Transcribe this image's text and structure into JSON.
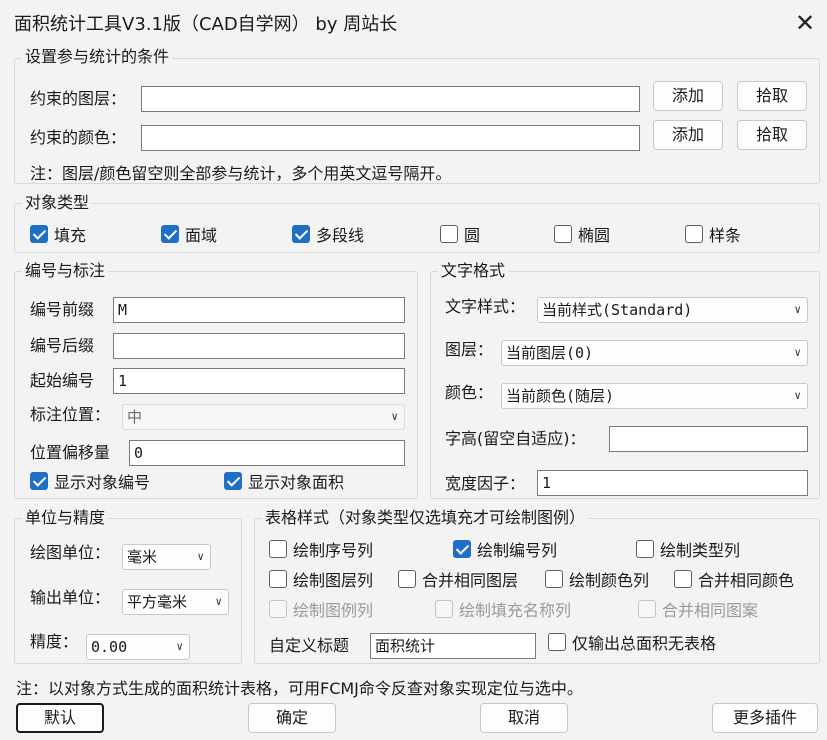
{
  "window": {
    "title": "面积统计工具V3.1版（CAD自学网） by 周站长",
    "close_glyph": "✕"
  },
  "conditions": {
    "title": "设置参与统计的条件",
    "layer_label": "约束的图层：",
    "layer_value": "",
    "color_label": "约束的颜色：",
    "color_value": "",
    "add_label": "添加",
    "pick_label": "拾取",
    "note": "注：图层/颜色留空则全部参与统计，多个用英文逗号隔开。"
  },
  "object_types": {
    "title": "对象类型",
    "items": [
      {
        "label": "填充",
        "checked": true
      },
      {
        "label": "面域",
        "checked": true
      },
      {
        "label": "多段线",
        "checked": true
      },
      {
        "label": "圆",
        "checked": false
      },
      {
        "label": "椭圆",
        "checked": false
      },
      {
        "label": "样条",
        "checked": false
      }
    ]
  },
  "numbering": {
    "title": "编号与标注",
    "prefix_label": "编号前缀",
    "prefix_value": "M",
    "suffix_label": "编号后缀",
    "suffix_value": "",
    "start_label": "起始编号",
    "start_value": "1",
    "position_label": "标注位置：",
    "position_value": "中",
    "offset_label": "位置偏移量",
    "offset_value": "0",
    "show_number_label": "显示对象编号",
    "show_number_checked": true,
    "show_area_label": "显示对象面积",
    "show_area_checked": true
  },
  "text_format": {
    "title": "文字格式",
    "style_label": "文字样式：",
    "style_value": "当前样式(Standard)",
    "layer_label": "图层：",
    "layer_value": "当前图层(0)",
    "color_label": "颜色：",
    "color_value": "当前颜色(随层)",
    "height_label": "字高(留空自适应)：",
    "height_value": "",
    "width_label": "宽度因子：",
    "width_value": "1"
  },
  "units": {
    "title": "单位与精度",
    "draw_unit_label": "绘图单位：",
    "draw_unit_value": "毫米",
    "out_unit_label": "输出单位：",
    "out_unit_value": "平方毫米",
    "precision_label": "精度：",
    "precision_value": "0.00"
  },
  "table": {
    "title": "表格样式（对象类型仅选填充才可绘制图例）",
    "options": [
      {
        "label": "绘制序号列",
        "checked": false,
        "enabled": true
      },
      {
        "label": "绘制编号列",
        "checked": true,
        "enabled": true
      },
      {
        "label": "绘制类型列",
        "checked": false,
        "enabled": true
      },
      {
        "label": "绘制图层列",
        "checked": false,
        "enabled": true
      },
      {
        "label": "合并相同图层",
        "checked": false,
        "enabled": true
      },
      {
        "label": "绘制颜色列",
        "checked": false,
        "enabled": true
      },
      {
        "label": "合并相同颜色",
        "checked": false,
        "enabled": true
      },
      {
        "label": "绘制图例列",
        "checked": false,
        "enabled": false
      },
      {
        "label": "绘制填充名称列",
        "checked": false,
        "enabled": false
      },
      {
        "label": "合并相同图案",
        "checked": false,
        "enabled": false
      }
    ],
    "custom_title_label": "自定义标题",
    "custom_title_value": "面积统计",
    "total_only_label": "仅输出总面积无表格",
    "total_only_checked": false
  },
  "footer": {
    "note": "注：以对象方式生成的面积统计表格，可用FCMJ命令反查对象实现定位与选中。",
    "default_label": "默认",
    "ok_label": "确定",
    "cancel_label": "取消",
    "more_label": "更多插件"
  },
  "colors": {
    "accent": "#1f6fc4",
    "background": "#f3f3f3"
  }
}
